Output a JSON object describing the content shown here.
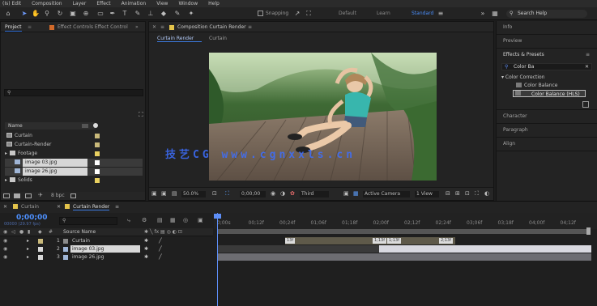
{
  "menu": [
    "(Is) Edit",
    "Composition",
    "Layer",
    "Effect",
    "Animation",
    "View",
    "Window",
    "Help"
  ],
  "toolbar": {
    "snapping_label": "Snapping",
    "workspaces": [
      "Default",
      "Learn",
      "Standard"
    ],
    "active_workspace_index": 2,
    "search_help": "Search Help"
  },
  "project": {
    "tabs": [
      "Project",
      "Effect Controls Effect Control"
    ],
    "header_label": "Name",
    "items": [
      {
        "name": "Curtain",
        "type": "comp",
        "label_color": "#c9b97a",
        "indent": 0
      },
      {
        "name": "Curtain-Render",
        "type": "comp",
        "label_color": "#c9b97a",
        "indent": 0
      },
      {
        "name": "Footage",
        "type": "folder",
        "label_color": "#e8d060",
        "indent": 0
      },
      {
        "name": "image 03.jpg",
        "type": "image",
        "label_color": "#ffffff",
        "indent": 1,
        "selected": true
      },
      {
        "name": "image 26.jpg",
        "type": "image",
        "label_color": "#ffffff",
        "indent": 1,
        "selected": true
      },
      {
        "name": "Solids",
        "type": "folder",
        "label_color": "#e8d060",
        "indent": 0
      }
    ],
    "bottom_field": "8 bpc"
  },
  "composition": {
    "panel_title": "Composition Curtain Render",
    "tabs": [
      "Curtain Render",
      "Curtain"
    ],
    "zoom": "50.0%",
    "timecode": "0;00;00",
    "resolution": "Third",
    "camera": "Active Camera",
    "view": "1 View",
    "watermark": "技艺CG www.cgnxxls.cn"
  },
  "right_panels": {
    "info": "Info",
    "preview": "Preview",
    "effects_presets": {
      "title": "Effects & Presets",
      "search_value": "Color Ba",
      "group": "Color Correction",
      "items": [
        "Color Balance",
        "Color Balance (HLS)"
      ]
    },
    "others": [
      "Character",
      "Paragraph",
      "Align"
    ]
  },
  "timeline": {
    "tabs": [
      "Curtain",
      "Curtain Render"
    ],
    "timecode": "0;00;00",
    "timecode_sub": "00000 (29.97 fps)",
    "column_header": "Source Name",
    "ruler": [
      "0;00s",
      "00;12f",
      "00;24f",
      "01;06f",
      "01;18f",
      "02;00f",
      "02;12f",
      "02;24f",
      "03;06f",
      "03;18f",
      "04;00f",
      "04;12f"
    ],
    "layers": [
      {
        "index": "1",
        "name": "Curtain",
        "label_color": "#c9b97a",
        "selected": false
      },
      {
        "index": "2",
        "name": "image 03.jpg",
        "label_color": "#d8d8d8",
        "selected": true
      },
      {
        "index": "3",
        "name": "image 26.jpg",
        "label_color": "#d8d8d8",
        "selected": false
      }
    ],
    "keyframes": [
      "13f",
      "1;13f",
      "1;13f",
      "2;13f"
    ]
  }
}
